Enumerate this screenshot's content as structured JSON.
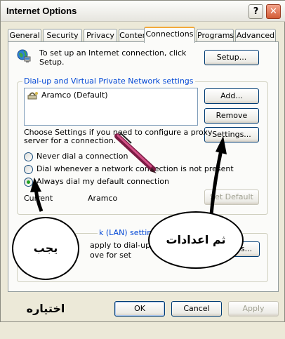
{
  "window": {
    "title": "Internet Options",
    "help_label": "?",
    "close_label": "✕"
  },
  "tabs": [
    "General",
    "Security",
    "Privacy",
    "Content",
    "Connections",
    "Programs",
    "Advanced"
  ],
  "active_tab": "Connections",
  "setup": {
    "text_line1": "To set up an Internet connection, click",
    "text_line2": "Setup.",
    "button_label": "Setup..."
  },
  "dialup": {
    "group_label": "Dial-up and Virtual Private Network settings",
    "connections": [
      "Aramco (Default)"
    ],
    "add_label": "Add...",
    "remove_label": "Remove",
    "settings_label": "Settings...",
    "proxy_text_line1": "Choose Settings if you need to configure a proxy",
    "proxy_text_line2": "server for a connection.",
    "radio_never": "Never dial a connection",
    "radio_whenever": "Dial whenever a network connection is not present",
    "radio_always": "Always dial my default connection",
    "selected_radio": "always",
    "current_label": "Current",
    "current_value": "Aramco",
    "set_default_label": "Set Default"
  },
  "lan": {
    "group_label_fragment": "k (LAN) settings",
    "text_line1_fragment": "apply to dial-up",
    "text_line2_fragment": "ove for set",
    "button_fragment": "s..."
  },
  "footer": {
    "ok_label": "OK",
    "cancel_label": "Cancel",
    "apply_label": "Apply"
  },
  "annotations": {
    "left_bubble": "يجب اختياره",
    "right_bubble": "ثم اعدادات"
  }
}
